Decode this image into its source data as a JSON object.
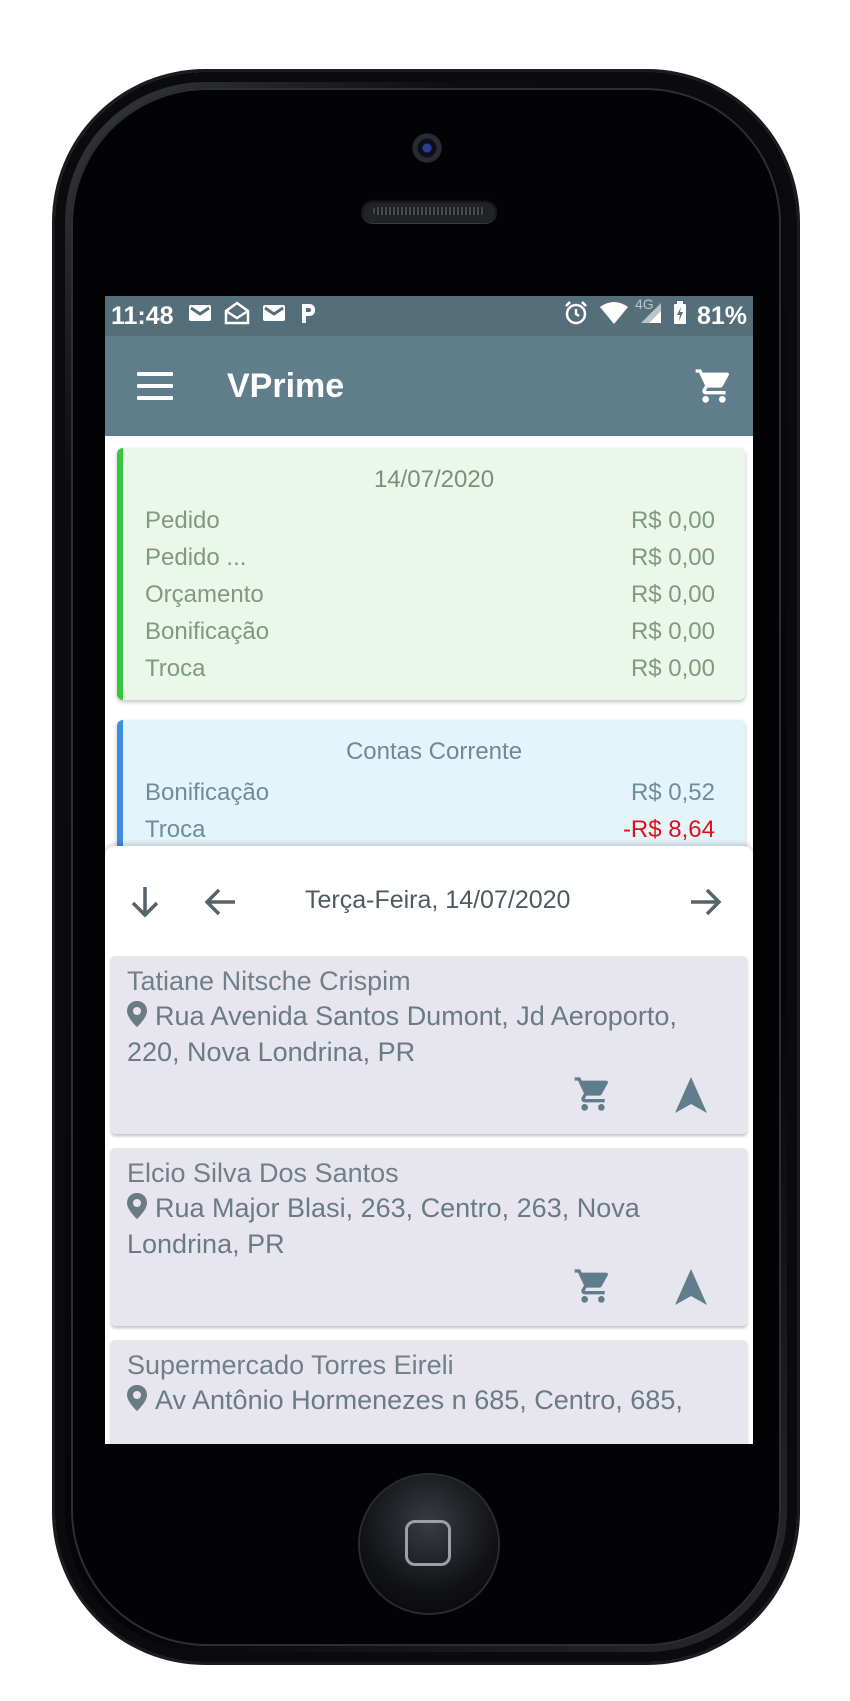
{
  "status_bar": {
    "time": "11:48",
    "network": "4G",
    "battery": "81%"
  },
  "app_bar": {
    "title": "VPrime"
  },
  "summary_card": {
    "date": "14/07/2020",
    "rows": [
      {
        "label": "Pedido",
        "value": "R$ 0,00"
      },
      {
        "label": "Pedido ...",
        "value": "R$ 0,00"
      },
      {
        "label": "Orçamento",
        "value": "R$ 0,00"
      },
      {
        "label": "Bonificação",
        "value": "R$ 0,00"
      },
      {
        "label": "Troca",
        "value": "R$ 0,00"
      }
    ],
    "accent_color": "#38c63f"
  },
  "accounts_card": {
    "title": "Contas Corrente",
    "rows": [
      {
        "label": "Bonificação",
        "value": "R$ 0,52"
      },
      {
        "label": "Troca",
        "value": "-R$ 8,64"
      }
    ],
    "accent_color": "#3d8de0",
    "negative_color": "#e0101a"
  },
  "date_nav": {
    "label": "Terça-Feira, 14/07/2020"
  },
  "clients": [
    {
      "name": "Tatiane Nitsche Crispim",
      "address": "Rua Avenida Santos Dumont, Jd Aeroporto, 220, Nova Londrina, PR"
    },
    {
      "name": "Elcio Silva Dos Santos",
      "address": "Rua Major Blasi, 263, Centro, 263, Nova Londrina, PR"
    },
    {
      "name": "Supermercado Torres Eireli",
      "address": "Av Antônio Hormenezes n 685, Centro, 685,"
    }
  ],
  "colors": {
    "app_bar": "#607d8b",
    "status_bar": "#546e7a"
  }
}
